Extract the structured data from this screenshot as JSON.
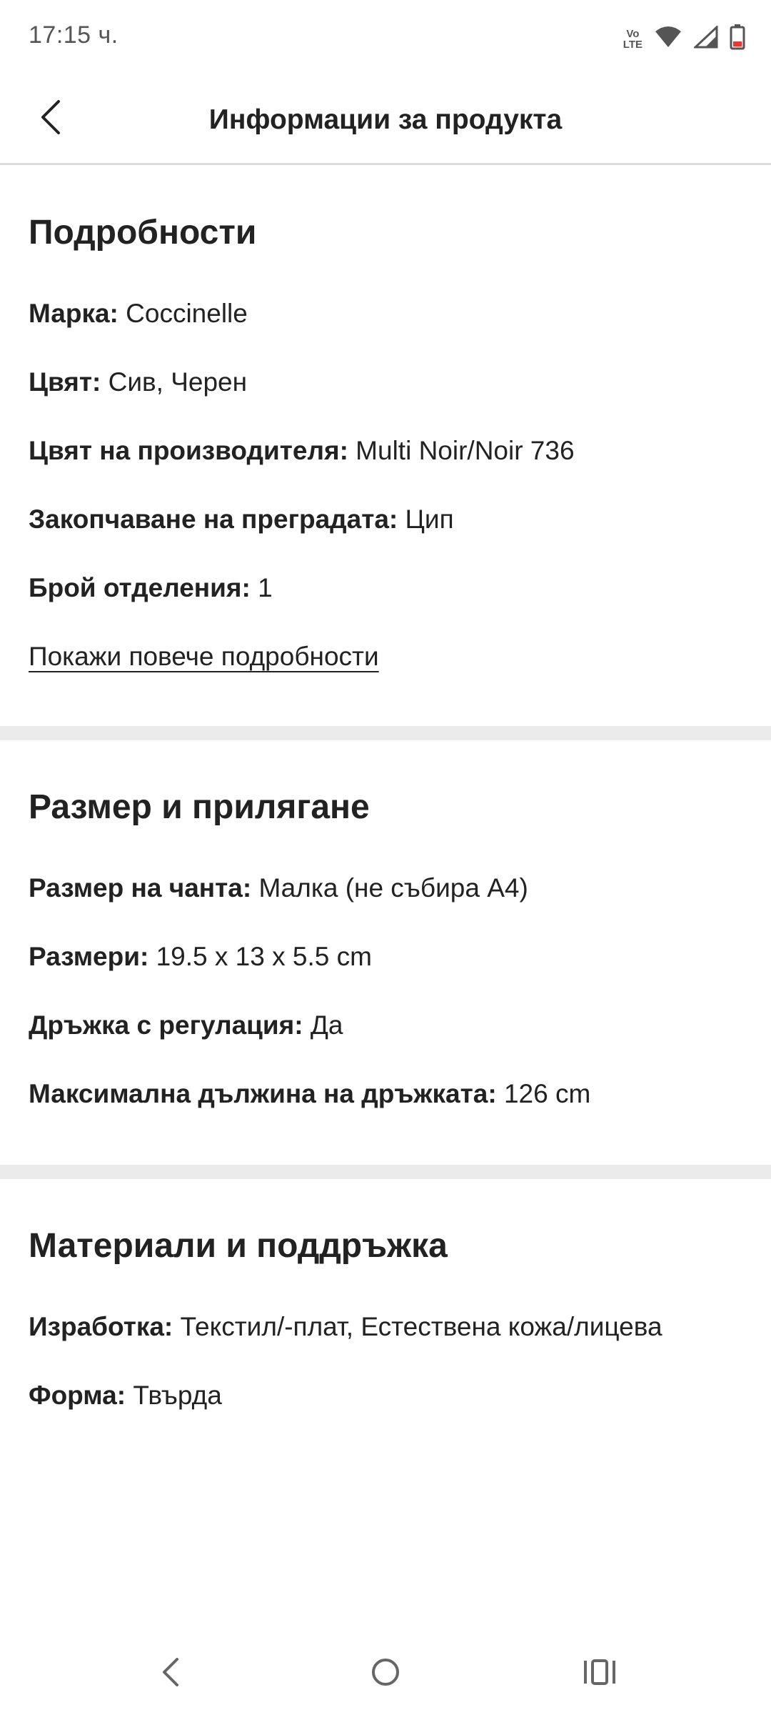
{
  "status_bar": {
    "time": "17:15 ч.",
    "volte_top": "Vo",
    "volte_bottom": "LTE",
    "icons": [
      "volte-icon",
      "wifi-icon",
      "signal-icon",
      "battery-icon"
    ],
    "battery_color": "#e53935"
  },
  "header": {
    "title": "Информации за продукта",
    "back_icon": "chevron-left-icon"
  },
  "details": {
    "title": "Подробности",
    "rows": [
      {
        "key": "Марка:",
        "value": "Coccinelle"
      },
      {
        "key": "Цвят:",
        "value": "Сив, Черен"
      },
      {
        "key": "Цвят на производителя:",
        "value": "Multi Noir/Noir 736"
      },
      {
        "key": "Закопчаване на преградата:",
        "value": "Цип"
      },
      {
        "key": "Брой отделения:",
        "value": "1"
      }
    ],
    "show_more": "Покажи повече подробности"
  },
  "size_fit": {
    "title": "Размер и прилягане",
    "rows": [
      {
        "key": "Размер на чанта:",
        "value": "Малка (не събира А4)"
      },
      {
        "key": "Размери:",
        "value": "19.5 x 13 x 5.5 cm"
      },
      {
        "key": "Дръжка с регулация:",
        "value": "Да"
      },
      {
        "key": "Максимална дължина на дръжката:",
        "value": "126 cm"
      }
    ]
  },
  "materials": {
    "title": "Материали и поддръжка",
    "rows": [
      {
        "key": "Изработка:",
        "value": "Текстил/-плат, Естествена кожа/лицева"
      },
      {
        "key": "Форма:",
        "value": "Твърда"
      }
    ]
  },
  "nav_bar": {
    "icons": [
      "nav-back-icon",
      "nav-home-icon",
      "nav-recents-icon"
    ]
  },
  "colors": {
    "text": "#222222",
    "divider": "#ebebeb",
    "status_gray": "#555555"
  }
}
